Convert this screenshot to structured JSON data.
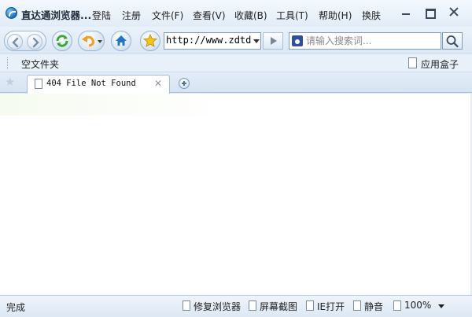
{
  "window": {
    "title": "直达通浏览器...",
    "controls": [
      "minimize",
      "maximize",
      "close"
    ]
  },
  "menu": [
    {
      "label": "登陆"
    },
    {
      "label": "注册"
    },
    {
      "label": "文件(F)"
    },
    {
      "label": "查看(V)"
    },
    {
      "label": "收藏(B)"
    },
    {
      "label": "工具(T)"
    },
    {
      "label": "帮助(H)"
    },
    {
      "label": "换肤"
    }
  ],
  "toolbar": {
    "icons": [
      "back-icon",
      "forward-icon",
      "refresh-icon",
      "undo-icon",
      "home-icon",
      "favorites-star-icon"
    ],
    "address_value": "http://www.zdtd",
    "search_placeholder": "请输入搜索词..."
  },
  "favorites_bar": {
    "folder_label": "空文件夹",
    "app_box_label": "应用盒子"
  },
  "tabs": [
    {
      "title": "404 File Not Found",
      "active": true
    }
  ],
  "status": {
    "text": "完成",
    "tools": [
      {
        "label": "修复浏览器"
      },
      {
        "label": "屏幕截图"
      },
      {
        "label": "IE打开"
      },
      {
        "label": "静音"
      },
      {
        "label": "100%"
      }
    ]
  },
  "colors": {
    "chrome": "#dfeaf6",
    "accent_blue": "#1a6fc0",
    "refresh_green": "#3aa838",
    "undo_orange": "#f0a020",
    "star_yellow": "#f5c518"
  }
}
